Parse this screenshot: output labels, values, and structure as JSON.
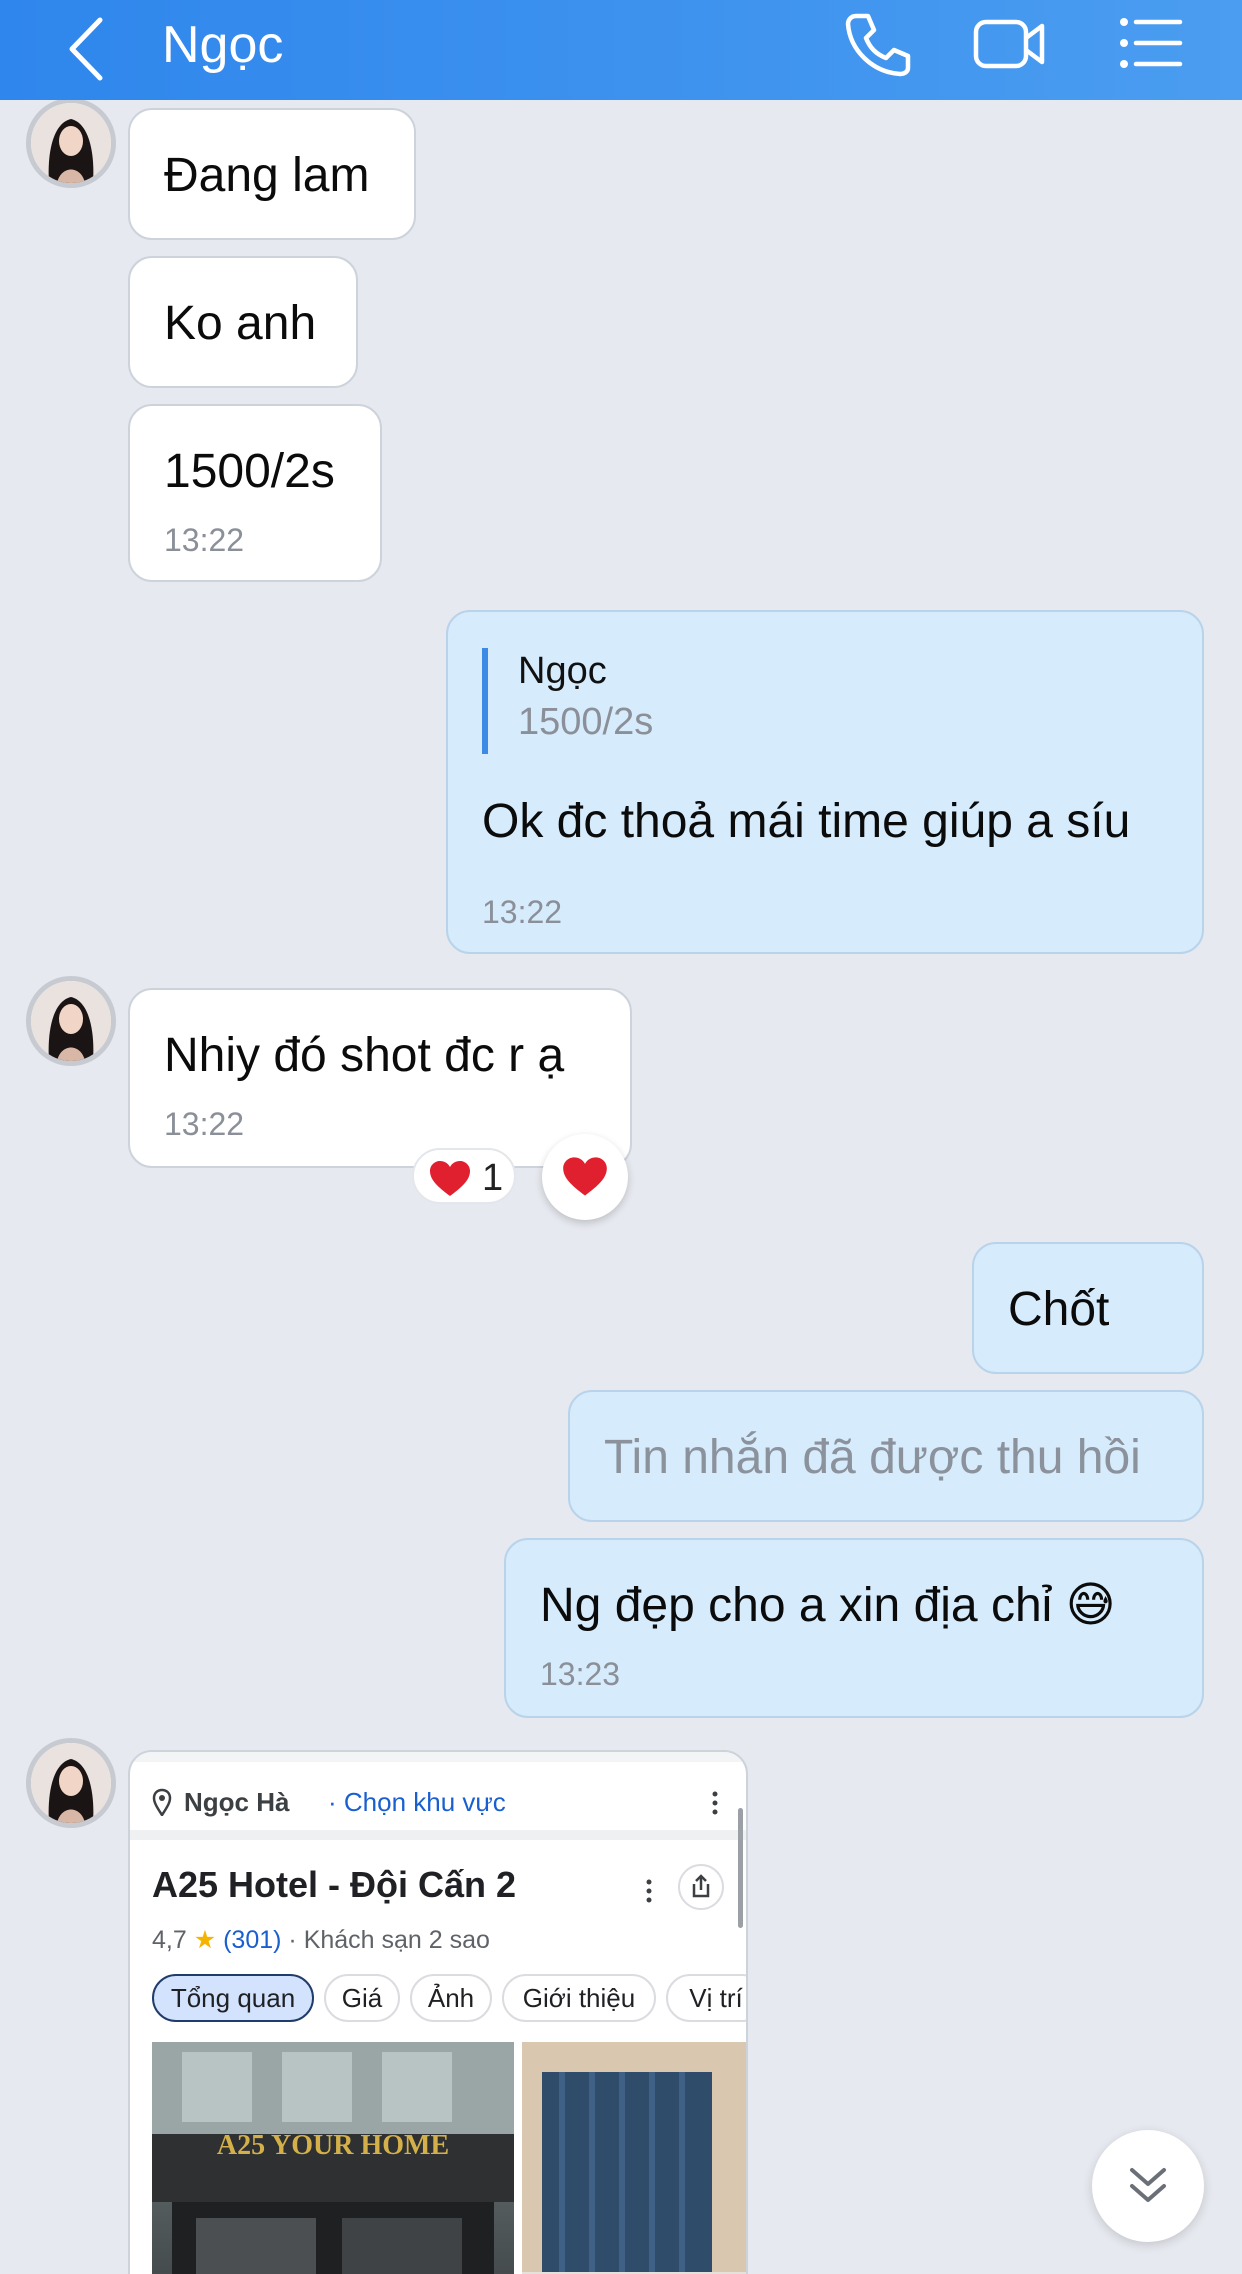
{
  "header": {
    "title": "Ngọc",
    "bg_color": "#2f86ec",
    "icons": [
      "back-chevron-icon",
      "phone-icon",
      "video-camera-icon",
      "list-menu-icon"
    ]
  },
  "messages": [
    {
      "side": "in",
      "text": "Đang lam"
    },
    {
      "side": "in",
      "text": "Ko anh"
    },
    {
      "side": "in",
      "text": "1500/2s",
      "time": "13:22"
    },
    {
      "side": "out",
      "reply_to": {
        "name": "Ngọc",
        "text": "1500/2s"
      },
      "text": "Ok đc thoả mái time giúp a síu",
      "time": "13:22"
    },
    {
      "side": "in",
      "text": "Nhiy đó shot đc r ạ",
      "time": "13:22",
      "reaction": {
        "emoji": "heart",
        "count": "1"
      }
    },
    {
      "side": "out",
      "text": "Chốt"
    },
    {
      "side": "out",
      "text": "Tin nhắn đã được thu hồi",
      "recalled": true
    },
    {
      "side": "out",
      "text": "Ng đẹp cho a xin địa chỉ 😅",
      "time": "13:23"
    }
  ],
  "shared_screenshot": {
    "location_name": "Ngọc Hà",
    "location_link": "· Chọn khu vực",
    "hotel_title": "A25 Hotel - Đội Cấn 2",
    "rating": "4,7",
    "review_count": "(301)",
    "category": "· Khách sạn 2 sao",
    "tabs": [
      "Tổng quan",
      "Giá",
      "Ảnh",
      "Giới thiệu",
      "Vị trí"
    ],
    "active_tab": "Tổng quan",
    "photo_sign": "A25 YOUR HOME"
  },
  "colors": {
    "incoming_bubble": "#ffffff",
    "outgoing_bubble": "#d6ebfc",
    "background": "#e6e9ef",
    "quote_bar": "#3b8ae6",
    "heart": "#e0202e"
  }
}
